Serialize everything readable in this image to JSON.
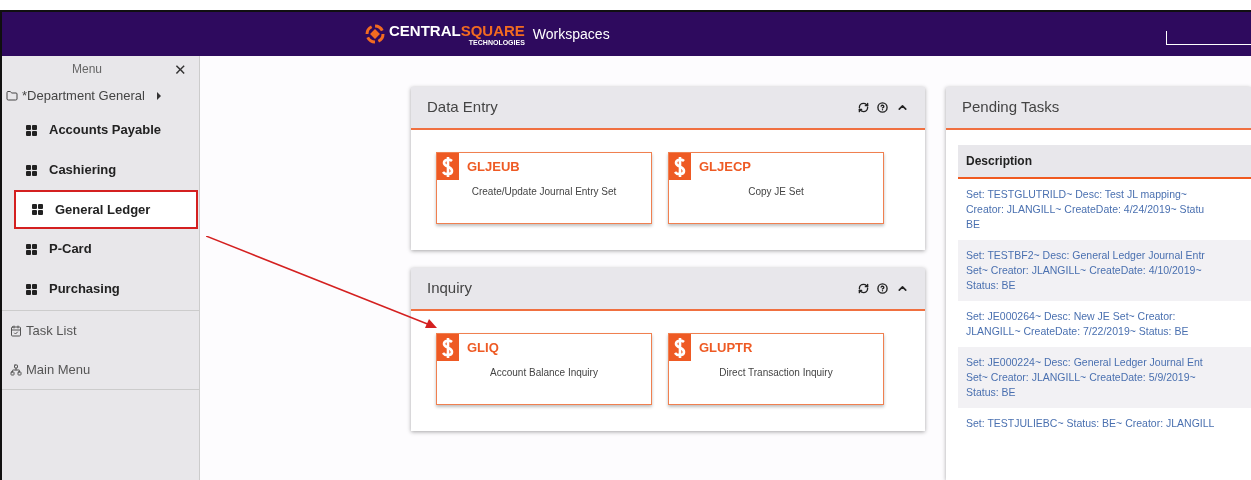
{
  "header": {
    "logo_main": "CENTRAL",
    "logo_accent": "SQUARE",
    "logo_sub": "TECHNOLOGIES",
    "title": "Workspaces"
  },
  "sidebar": {
    "title": "Menu",
    "close": "✕",
    "folder": {
      "label": "*Department General"
    },
    "items": [
      {
        "label": "Accounts Payable",
        "selected": false
      },
      {
        "label": "Cashiering",
        "selected": false
      },
      {
        "label": "General Ledger",
        "selected": true
      },
      {
        "label": "P-Card",
        "selected": false
      },
      {
        "label": "Purchasing",
        "selected": false
      }
    ],
    "links": [
      {
        "label": "Task List",
        "kind": "tasks"
      },
      {
        "label": "Main Menu",
        "kind": "sitemap"
      }
    ]
  },
  "panels": [
    {
      "title": "Data Entry",
      "tiles": [
        {
          "code": "GLJEUB",
          "description": "Create/Update Journal Entry Set"
        },
        {
          "code": "GLJECP",
          "description": "Copy JE Set"
        }
      ]
    },
    {
      "title": "Inquiry",
      "tiles": [
        {
          "code": "GLIQ",
          "description": "Account Balance Inquiry"
        },
        {
          "code": "GLUPTR",
          "description": "Direct Transaction Inquiry"
        }
      ]
    }
  ],
  "pending_tasks": {
    "title": "Pending Tasks",
    "column": "Description",
    "rows": [
      {
        "lines": [
          "Set: TESTGLUTRILD~ Desc: Test JL mapping~",
          "Creator: JLANGILL~ CreateDate: 4/24/2019~ Statu",
          "BE"
        ]
      },
      {
        "lines": [
          "Set: TESTBF2~ Desc: General Ledger Journal Entr",
          "Set~ Creator: JLANGILL~ CreateDate: 4/10/2019~",
          "Status: BE"
        ]
      },
      {
        "lines": [
          "Set: JE000264~ Desc: New JE Set~ Creator:",
          "JLANGILL~ CreateDate: 7/22/2019~ Status: BE"
        ]
      },
      {
        "lines": [
          "Set: JE000224~ Desc: General Ledger Journal Ent",
          "Set~ Creator: JLANGILL~ CreateDate: 5/9/2019~",
          "Status: BE"
        ]
      },
      {
        "lines": [
          "Set: TESTJULIEBC~ Status: BE~ Creator: JLANGILL"
        ]
      }
    ]
  }
}
